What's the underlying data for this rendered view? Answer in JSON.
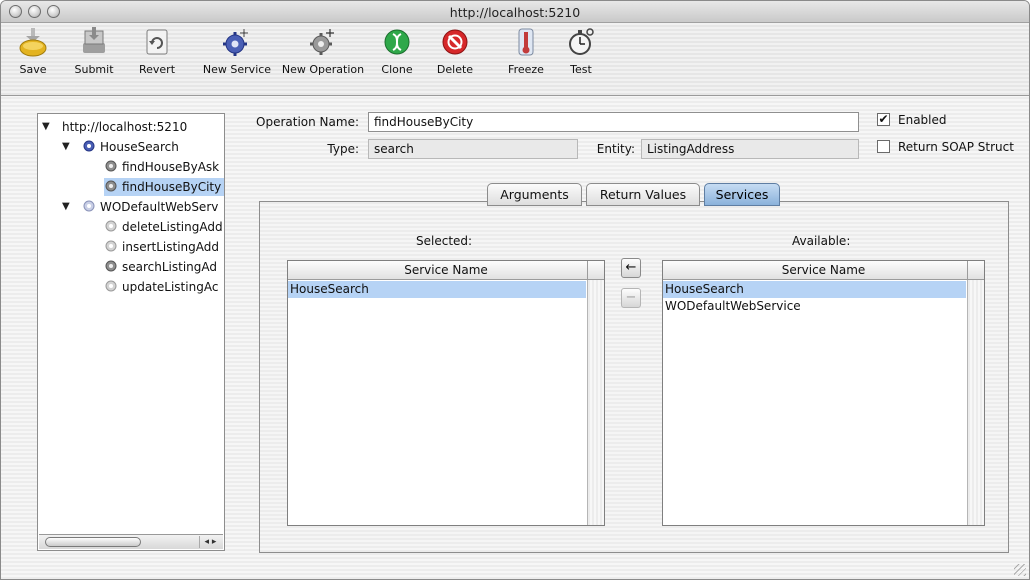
{
  "window": {
    "title": "http://localhost:5210"
  },
  "toolbar": {
    "items": [
      {
        "label": "Save",
        "icon": "save-icon"
      },
      {
        "label": "Submit",
        "icon": "submit-icon"
      },
      {
        "label": "Revert",
        "icon": "revert-icon"
      },
      {
        "label": "New Service",
        "icon": "new-service-icon"
      },
      {
        "label": "New Operation",
        "icon": "new-operation-icon"
      },
      {
        "label": "Clone",
        "icon": "clone-icon"
      },
      {
        "label": "Delete",
        "icon": "delete-icon"
      },
      {
        "label": "Freeze",
        "icon": "freeze-icon"
      },
      {
        "label": "Test",
        "icon": "test-icon"
      }
    ]
  },
  "tree": {
    "root": "http://localhost:5210",
    "services": [
      {
        "name": "HouseSearch",
        "operations": [
          "findHouseByAsk",
          "findHouseByCity"
        ]
      },
      {
        "name": "WODefaultWebServ",
        "operations": [
          "deleteListingAdd",
          "insertListingAdd",
          "searchListingAd",
          "updateListingAc"
        ]
      }
    ],
    "selected": "findHouseByCity"
  },
  "form": {
    "operation_name_label": "Operation Name:",
    "operation_name_value": "findHouseByCity",
    "type_label": "Type:",
    "type_value": "search",
    "entity_label": "Entity:",
    "entity_value": "ListingAddress",
    "enabled_label": "Enabled",
    "enabled_checked": true,
    "return_soap_label": "Return SOAP Struct",
    "return_soap_checked": false
  },
  "tabs": [
    {
      "label": "Arguments",
      "active": false
    },
    {
      "label": "Return Values",
      "active": false
    },
    {
      "label": "Services",
      "active": true
    }
  ],
  "services_tab": {
    "selected_caption": "Selected:",
    "available_caption": "Available:",
    "column_header": "Service Name",
    "selected_list": [
      "HouseSearch"
    ],
    "available_list": [
      "HouseSearch",
      "WODefaultWebService"
    ],
    "add_button": "←",
    "remove_button": "−"
  },
  "colors": {
    "selection": "#b6d3f5",
    "active_tab": "#8bb2db"
  }
}
